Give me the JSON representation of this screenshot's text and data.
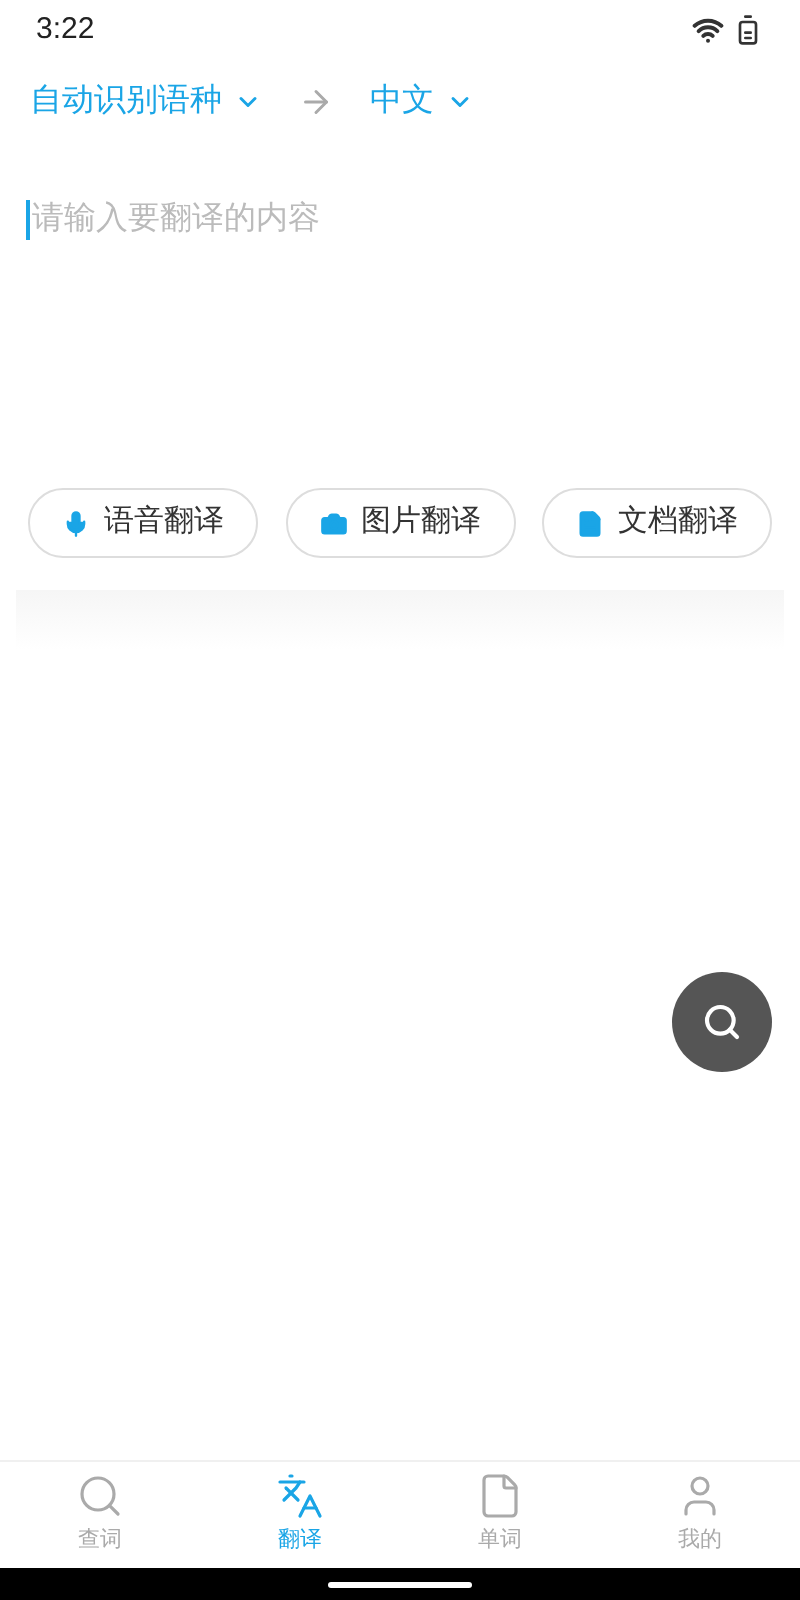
{
  "status_bar": {
    "time": "3:22"
  },
  "languages": {
    "source": "自动识别语种",
    "target": "中文"
  },
  "input": {
    "placeholder": "请输入要翻译的内容"
  },
  "actions": [
    {
      "kind": "voice",
      "label": "语音翻译"
    },
    {
      "kind": "image",
      "label": "图片翻译"
    },
    {
      "kind": "document",
      "label": "文档翻译"
    }
  ],
  "bottom_nav": [
    {
      "kind": "search",
      "label": "查词",
      "selected": false
    },
    {
      "kind": "translate",
      "label": "翻译",
      "selected": true
    },
    {
      "kind": "words",
      "label": "单词",
      "selected": false
    },
    {
      "kind": "profile",
      "label": "我的",
      "selected": false
    }
  ]
}
